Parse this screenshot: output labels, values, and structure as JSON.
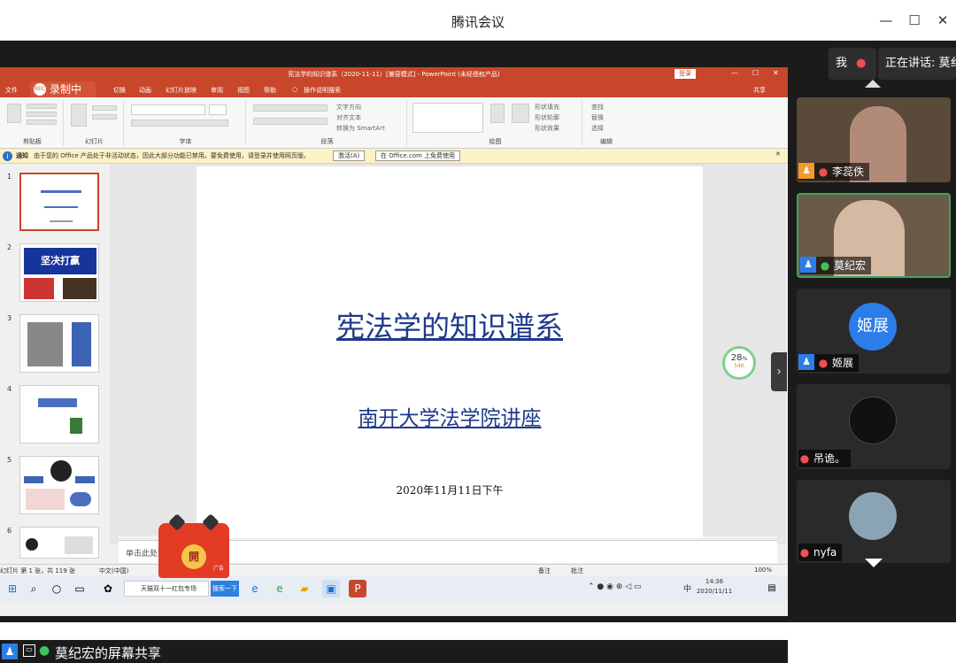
{
  "app": {
    "title": "腾讯会议",
    "minimize": "—",
    "maximize": "☐",
    "close": "✕"
  },
  "ppt": {
    "window_title": "宪法学的知识谱系（2020-11-11）[兼容模式] - PowerPoint (未经授权产品)",
    "login": "登录",
    "menu": [
      "文件",
      "切换",
      "动画",
      "幻灯片放映",
      "审阅",
      "视图",
      "帮助",
      "操作说明搜索",
      "共享"
    ],
    "recording_label": "录制中",
    "ribbon_groups": [
      "剪贴板",
      "幻灯片",
      "字体",
      "段落",
      "绘图",
      "编辑"
    ],
    "ribbon_items": {
      "new_slide": "新建\n幻灯片",
      "text_direction": "文字方向",
      "align_text": "对齐文本",
      "smartart": "转换为 SmartArt",
      "arrange": "排列",
      "quick_styles": "快速样式",
      "shape_fill": "形状填充",
      "shape_outline": "形状轮廓",
      "shape_effects": "形状效果",
      "find": "查找",
      "replace": "替换",
      "select": "选择"
    },
    "info": {
      "tag": "通知",
      "text": "由于您的 Office 产品处于非活动状态，因此大部分功能已禁用。要免费使用，请登录并使用网页版。",
      "activate": "激活(A)",
      "online": "在 Office.com 上免费使用"
    },
    "slide_numbers": [
      "1",
      "2",
      "3",
      "4",
      "5",
      "6"
    ],
    "slide": {
      "title": "宪法学的知识谱系",
      "subtitle": "南开大学法学院讲座",
      "date": "2020年11月11日下午"
    },
    "notes_placeholder": "单击此处添加备注",
    "status": {
      "slide_count": "幻灯片 第 1 张，共 119 张",
      "lang": "中文(中国)",
      "notes": "备注",
      "comments": "批注",
      "zoom": "100%"
    },
    "thumb2_text": "坚决打赢"
  },
  "taskbar": {
    "search_app": "天猫双十一红包专场",
    "search_btn": "搜索一下",
    "time": "14:36",
    "date": "2020/11/11",
    "ime": "中"
  },
  "red_packet": {
    "label": "開",
    "ad": "广告"
  },
  "progress": {
    "value": "28",
    "unit": "%",
    "sub": "54K"
  },
  "share_bar": {
    "text": "莫纪宏的屏幕共享"
  },
  "speaker": {
    "me": "我",
    "speaking": "正在讲话: 莫纟"
  },
  "participants": [
    {
      "name": "李蕊佚",
      "mic": "muted"
    },
    {
      "name": "莫纪宏",
      "mic": "on"
    },
    {
      "name": "姬展",
      "avatar": "姬展",
      "mic": "muted"
    },
    {
      "name": "吊诡。",
      "mic": "muted"
    },
    {
      "name": "nyfa",
      "mic": "muted"
    }
  ],
  "colors": {
    "ppt_accent": "#c8462a",
    "slide_text": "#1e3a8a",
    "tencent_blue": "#2b7de9",
    "active_border": "#3fa65a"
  }
}
